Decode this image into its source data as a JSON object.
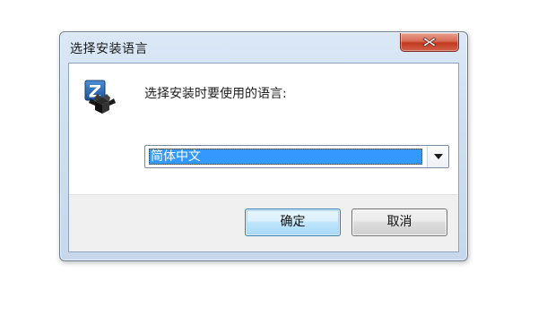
{
  "window": {
    "title": "选择安装语言"
  },
  "dialog": {
    "prompt": "选择安装时要使用的语言:",
    "language_select": {
      "selected": "简体中文"
    },
    "buttons": {
      "ok_label": "确定",
      "cancel_label": "取消"
    },
    "icon": "installer-box-icon"
  },
  "colors": {
    "selection_highlight": "#3399ff",
    "close_button": "#c0391f"
  }
}
